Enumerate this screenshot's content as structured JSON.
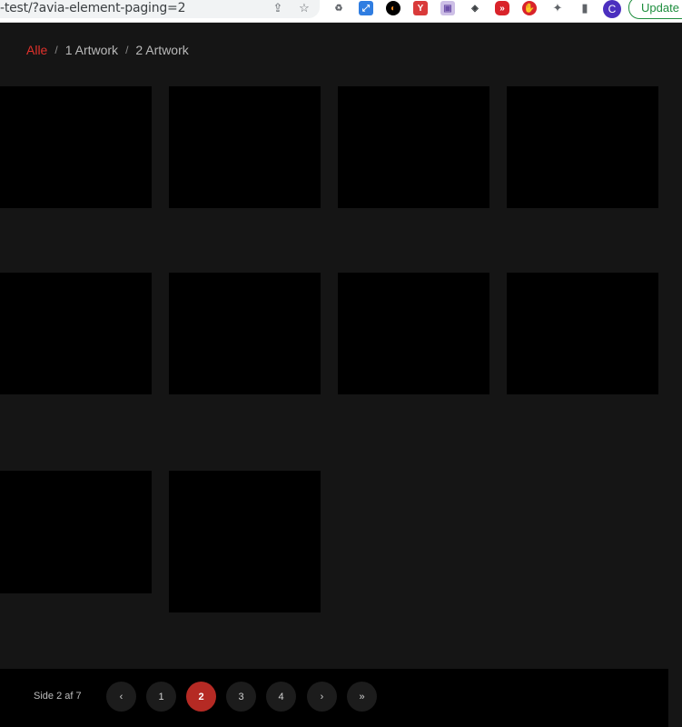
{
  "browser": {
    "url": "-test/?avia-element-paging=2",
    "avatar_letter": "C",
    "update_label": "Update",
    "extensions": [
      {
        "name": "recycle-extension-icon",
        "glyph": "♻",
        "color": "#5f6368"
      },
      {
        "name": "expand-extension-icon",
        "glyph": "⤢",
        "color": "#2f7de1"
      },
      {
        "name": "orange-moon-extension-icon",
        "glyph": "◐",
        "color": "#e8711a"
      },
      {
        "name": "yoast-extension-icon",
        "glyph": "Y",
        "color": "#d93a3a"
      },
      {
        "name": "robot-extension-icon",
        "glyph": "▣",
        "color": "#9b7fc7"
      },
      {
        "name": "tag-extension-icon",
        "glyph": "◈",
        "color": "#5f6368"
      },
      {
        "name": "fast-forward-extension-icon",
        "glyph": "»",
        "color": "#d9232a"
      },
      {
        "name": "stop-hand-extension-icon",
        "glyph": "✋",
        "color": "#d9232a"
      }
    ]
  },
  "filters": {
    "items": [
      "Alle",
      "1 Artwork",
      "2 Artwork"
    ],
    "active_index": 0,
    "separator": "/"
  },
  "pagination": {
    "info": "Side 2 af 7",
    "prev": "‹",
    "pages": [
      "1",
      "2",
      "3",
      "4"
    ],
    "current": "2",
    "next": "›",
    "last": "»"
  },
  "colors": {
    "background": "#151515",
    "tile": "#000000",
    "accent": "#e0312b",
    "current_page": "#b52a24"
  }
}
